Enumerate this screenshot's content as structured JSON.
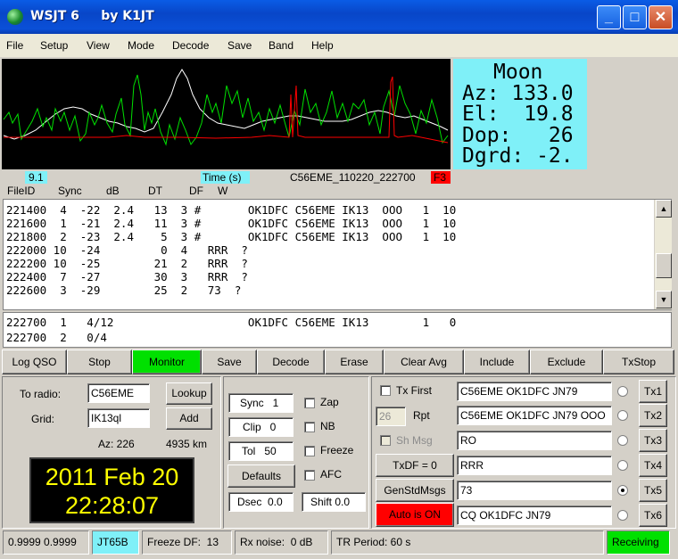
{
  "window": {
    "title": "WSJT 6     by K1JT",
    "min": "_",
    "max": "□",
    "close": "✕"
  },
  "menu": [
    "File",
    "Setup",
    "View",
    "Mode",
    "Decode",
    "Save",
    "Band",
    "Help"
  ],
  "moon": {
    "title": "Moon",
    "az": "Az: 133.0",
    "el": "El:  19.8",
    "dop": "Dop:   26",
    "dgrd": "Dgrd: -2."
  },
  "graph_info": {
    "freq": "9.1",
    "time_label": "Time (s)",
    "file": "C56EME_110220_222700",
    "f_key": "F3"
  },
  "columns": {
    "fileid": "FileID",
    "sync": "Sync",
    "db": "dB",
    "dt": "DT",
    "df": "DF",
    "w": "W"
  },
  "decodes": [
    "221400  4  -22  2.4   13  3 #       OK1DFC C56EME IK13  OOO   1  10",
    "221600  1  -21  2.4   11  3 #       OK1DFC C56EME IK13  OOO   1  10",
    "221800  2  -23  2.4    5  3 #       OK1DFC C56EME IK13  OOO   1  10",
    "222000 10  -24         0  4   RRR  ?",
    "222200 10  -25        21  2   RRR  ?",
    "222400  7  -27        30  3   RRR  ?",
    "222600  3  -29        25  2   73  ?"
  ],
  "averages": [
    "222700  1   4/12                    OK1DFC C56EME IK13        1   0",
    "222700  2   0/4"
  ],
  "buttons": [
    "Log QSO",
    "Stop",
    "Monitor",
    "Save",
    "Decode",
    "Erase",
    "Clear Avg",
    "Include",
    "Exclude",
    "TxStop"
  ],
  "station": {
    "to_radio_label": "To radio:",
    "to_radio": "C56EME",
    "grid_label": "Grid:",
    "grid": "IK13ql",
    "lookup": "Lookup",
    "add": "Add",
    "az": "Az: 226",
    "dist": "4935 km"
  },
  "clock": {
    "date": "2011 Feb 20",
    "time": "22:28:07"
  },
  "controls": {
    "sync": "Sync   1",
    "clip": "Clip   0",
    "tol": "Tol   50",
    "defaults": "Defaults",
    "dsec": "Dsec  0.0",
    "shift": "Shift 0.0",
    "zap": "Zap",
    "nb": "NB",
    "freeze": "Freeze",
    "afc": "AFC"
  },
  "tx": {
    "tx_first": "Tx First",
    "rpt_value": "26",
    "rpt": "Rpt",
    "sh_msg": "Sh Msg",
    "txdf": "TxDF = 0",
    "genstd": "GenStdMsgs",
    "auto": "Auto is ON",
    "messages": [
      "C56EME OK1DFC JN79",
      "C56EME OK1DFC JN79 OOO",
      "RO",
      "RRR",
      "73",
      "CQ OK1DFC JN79"
    ],
    "tx_buttons": [
      "Tx1",
      "Tx2",
      "Tx3",
      "Tx4",
      "Tx5",
      "Tx6"
    ],
    "selected": 4
  },
  "statusbar": {
    "nums": "0.9999 0.9999",
    "mode": "JT65B",
    "freeze": "Freeze DF:  13",
    "noise": "Rx noise:  0 dB",
    "period": "TR Period: 60 s",
    "state": "Receiving"
  },
  "colors": {
    "moon_bg": "#7ff0f8",
    "monitor": "#00e000",
    "auto": "#ff0000",
    "clock_fg": "#ffff00",
    "receiving": "#00e000",
    "f3": "#ff0000"
  }
}
